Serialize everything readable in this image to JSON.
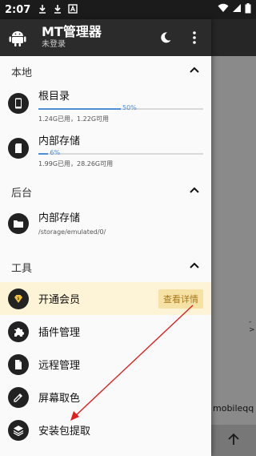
{
  "status_bar": {
    "time": "2:07",
    "icons": [
      "download-icon",
      "download-icon",
      "app-icon"
    ],
    "right_icons": [
      "wifi-icon",
      "signal-icon",
      "battery-icon"
    ]
  },
  "header": {
    "title": "MT管理器",
    "subtitle": "未登录"
  },
  "sections": {
    "local": "本地",
    "background": "后台",
    "tools": "工具"
  },
  "storage": [
    {
      "name": "根目录",
      "percent_label": "50%",
      "percent": 50,
      "detail": "1.24G已用，1.22G可用"
    },
    {
      "name": "内部存储",
      "percent_label": "6%",
      "percent": 6,
      "detail": "1.99G已用，28.26G可用"
    }
  ],
  "background_item": {
    "name": "内部存储",
    "path": "/storage/emulated/0/"
  },
  "tools": [
    {
      "label": "开通会员",
      "button": "查看详情"
    },
    {
      "label": "插件管理"
    },
    {
      "label": "远程管理"
    },
    {
      "label": "屏幕取色"
    },
    {
      "label": "安装包提取"
    }
  ],
  "background_app": {
    "text": "mobileqq",
    "small_arrow": "->"
  },
  "colors": {
    "accent": "#4f8fd8",
    "header": "#2b2b2b",
    "highlight": "#fdf3d6",
    "annotation": "#e02020"
  }
}
